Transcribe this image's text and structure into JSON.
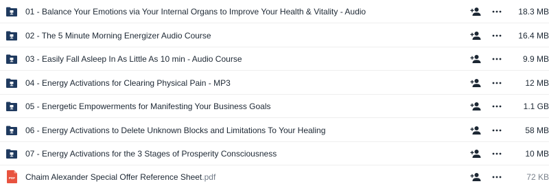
{
  "files": [
    {
      "name": "01 - Balance Your Emotions via Your Internal Organs to Improve Your Health & Vitality - Audio",
      "ext": "",
      "size": "18.3 MB",
      "type": "folder",
      "icon": "folder-icon"
    },
    {
      "name": "02 - The 5 Minute Morning Energizer Audio Course",
      "ext": "",
      "size": "16.4 MB",
      "type": "folder",
      "icon": "folder-icon"
    },
    {
      "name": "03 - Easily Fall Asleep In As Little As 10 min - Audio Course",
      "ext": "",
      "size": "9.9 MB",
      "type": "folder",
      "icon": "folder-icon"
    },
    {
      "name": "04 - Energy Activations for Clearing Physical Pain - MP3",
      "ext": "",
      "size": "12 MB",
      "type": "folder",
      "icon": "folder-icon"
    },
    {
      "name": "05 - Energetic Empowerments for Manifesting Your Business Goals",
      "ext": "",
      "size": "1.1 GB",
      "type": "folder",
      "icon": "folder-icon"
    },
    {
      "name": "06 - Energy Activations to Delete Unknown Blocks and Limitations To Your Healing",
      "ext": "",
      "size": "58 MB",
      "type": "folder",
      "icon": "folder-icon"
    },
    {
      "name": "07 - Energy Activations for the 3 Stages of Prosperity Consciousness",
      "ext": "",
      "size": "10 MB",
      "type": "folder",
      "icon": "folder-icon"
    },
    {
      "name": "Chaim Alexander Special Offer Reference Sheet",
      "ext": ".pdf",
      "size": "72 KB",
      "type": "pdf",
      "icon": "pdf-file-icon",
      "badge": "PDF"
    }
  ],
  "actions": {
    "share_icon": "add-person-icon",
    "more_icon": "more-options-icon"
  },
  "colors": {
    "folder": "#1f3a5f",
    "text": "#1c2733",
    "pdf": "#e8533f"
  }
}
